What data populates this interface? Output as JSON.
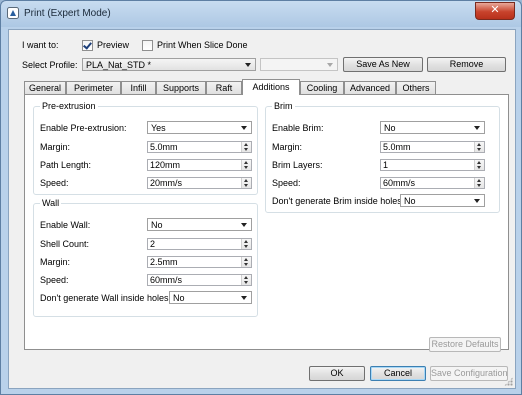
{
  "window": {
    "title": "Print (Expert Mode)",
    "close_label": "✕"
  },
  "top": {
    "i_want_to_label": "I want to:",
    "preview": {
      "label": "Preview",
      "checked": true
    },
    "print_when_slice_done": {
      "label": "Print When Slice Done",
      "checked": false
    },
    "select_profile_label": "Select Profile:",
    "profile_value": "PLA_Nat_STD *",
    "second_combo_value": "",
    "save_as_new_label": "Save As New",
    "remove_label": "Remove"
  },
  "tabs": [
    {
      "label": "General"
    },
    {
      "label": "Perimeter"
    },
    {
      "label": "Infill"
    },
    {
      "label": "Supports"
    },
    {
      "label": "Raft"
    },
    {
      "label": "Additions",
      "active": true
    },
    {
      "label": "Cooling"
    },
    {
      "label": "Advanced"
    },
    {
      "label": "Others"
    }
  ],
  "pre_extrusion": {
    "title": "Pre-extrusion",
    "enable_label": "Enable Pre-extrusion:",
    "enable_value": "Yes",
    "margin_label": "Margin:",
    "margin_value": "5.0mm",
    "path_length_label": "Path Length:",
    "path_length_value": "120mm",
    "speed_label": "Speed:",
    "speed_value": "20mm/s"
  },
  "wall": {
    "title": "Wall",
    "enable_label": "Enable Wall:",
    "enable_value": "No",
    "shell_count_label": "Shell Count:",
    "shell_count_value": "2",
    "margin_label": "Margin:",
    "margin_value": "2.5mm",
    "speed_label": "Speed:",
    "speed_value": "60mm/s",
    "inside_holes_label": "Don't generate Wall inside holes:",
    "inside_holes_value": "No"
  },
  "brim": {
    "title": "Brim",
    "enable_label": "Enable Brim:",
    "enable_value": "No",
    "margin_label": "Margin:",
    "margin_value": "5.0mm",
    "layers_label": "Brim Layers:",
    "layers_value": "1",
    "speed_label": "Speed:",
    "speed_value": "60mm/s",
    "inside_holes_label": "Don't generate Brim inside holes:",
    "inside_holes_value": "No"
  },
  "footer": {
    "restore_defaults_label": "Restore Defaults",
    "ok_label": "OK",
    "cancel_label": "Cancel",
    "save_configuration_label": "Save Configuration"
  },
  "icons": {
    "app": "printer-app-icon",
    "close": "close-icon",
    "combo_arrow": "chevron-down-icon",
    "spin": "spin-arrows-icon"
  },
  "colors": {
    "title_bar": "#b9d1ea",
    "close_button": "#c8432c",
    "default_button_border": "#3c7fb1"
  }
}
